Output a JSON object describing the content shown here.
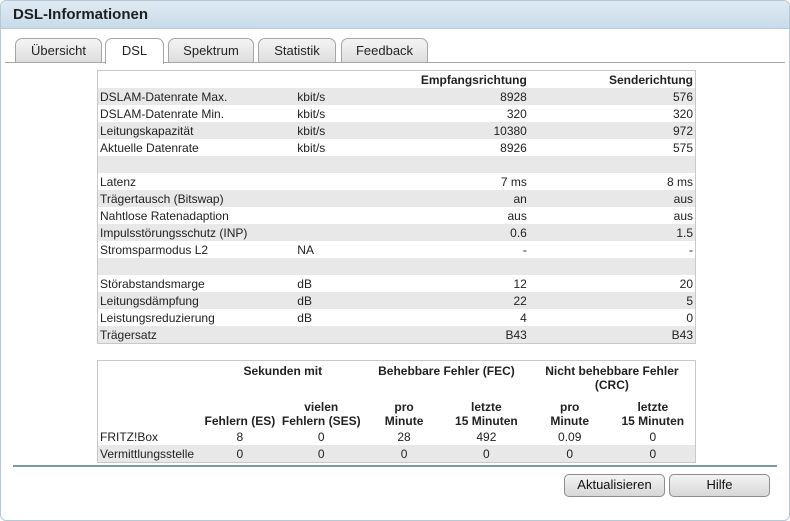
{
  "window": {
    "title": "DSL-Informationen"
  },
  "tabs": [
    {
      "label": "Übersicht",
      "active": false
    },
    {
      "label": "DSL",
      "active": true
    },
    {
      "label": "Spektrum",
      "active": false
    },
    {
      "label": "Statistik",
      "active": false
    },
    {
      "label": "Feedback",
      "active": false
    }
  ],
  "line_table": {
    "headers": {
      "empfang": "Empfangsrichtung",
      "sende": "Senderichtung"
    },
    "rows": [
      {
        "label": "DSLAM-Datenrate Max.",
        "unit": "kbit/s",
        "rx": "8928",
        "tx": "576"
      },
      {
        "label": "DSLAM-Datenrate Min.",
        "unit": "kbit/s",
        "rx": "320",
        "tx": "320"
      },
      {
        "label": "Leitungskapazität",
        "unit": "kbit/s",
        "rx": "10380",
        "tx": "972"
      },
      {
        "label": "Aktuelle Datenrate",
        "unit": "kbit/s",
        "rx": "8926",
        "tx": "575"
      },
      {
        "label": "",
        "unit": "",
        "rx": "",
        "tx": ""
      },
      {
        "label": "Latenz",
        "unit": "",
        "rx": "7 ms",
        "tx": "8 ms"
      },
      {
        "label": "Trägertausch (Bitswap)",
        "unit": "",
        "rx": "an",
        "tx": "aus"
      },
      {
        "label": "Nahtlose Ratenadaption",
        "unit": "",
        "rx": "aus",
        "tx": "aus"
      },
      {
        "label": "Impulsstörungsschutz (INP)",
        "unit": "",
        "rx": "0.6",
        "tx": "1.5"
      },
      {
        "label": "Stromsparmodus L2",
        "unit": "NA",
        "rx": "-",
        "tx": "-"
      },
      {
        "label": "",
        "unit": "",
        "rx": "",
        "tx": ""
      },
      {
        "label": "Störabstandsmarge",
        "unit": "dB",
        "rx": "12",
        "tx": "20"
      },
      {
        "label": "Leitungsdämpfung",
        "unit": "dB",
        "rx": "22",
        "tx": "5"
      },
      {
        "label": "Leistungsreduzierung",
        "unit": "dB",
        "rx": "4",
        "tx": "0"
      },
      {
        "label": "Trägersatz",
        "unit": "",
        "rx": "B43",
        "tx": "B43"
      }
    ]
  },
  "error_table": {
    "groups": {
      "seconds": "Sekunden mit",
      "fec": "Behebbare Fehler (FEC)",
      "crc": "Nicht behebbare Fehler (CRC)"
    },
    "subheaders": {
      "es": "Fehlern (ES)",
      "ses_1": "vielen",
      "ses_2": "Fehlern (SES)",
      "pro_1": "pro",
      "pro_2": "Minute",
      "letzte_1": "letzte",
      "letzte_2": "15 Minuten"
    },
    "rows": [
      {
        "label": "FRITZ!Box",
        "es": "8",
        "ses": "0",
        "fec_min": "28",
        "fec_15": "492",
        "crc_min": "0.09",
        "crc_15": "0"
      },
      {
        "label": "Vermittlungsstelle",
        "es": "0",
        "ses": "0",
        "fec_min": "0",
        "fec_15": "0",
        "crc_min": "0",
        "crc_15": "0"
      }
    ]
  },
  "buttons": {
    "refresh": "Aktualisieren",
    "help": "Hilfe"
  }
}
